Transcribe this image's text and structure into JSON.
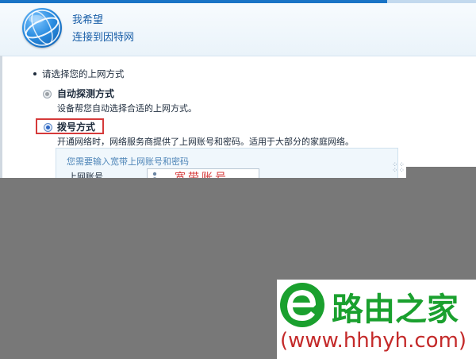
{
  "header": {
    "title": "我希望",
    "subtitle": "连接到因特网",
    "logo_icon": "globe-icon"
  },
  "question": "请选择您的上网方式",
  "options": [
    {
      "label": "自动探测方式",
      "description": "设备帮您自动选择合适的上网方式。",
      "selected": false
    },
    {
      "label": "拨号方式",
      "description": "开通网络时，网络服务商提供了上网账号和密码。适用于大部分的家庭网络。",
      "selected": true
    }
  ],
  "dial_panel": {
    "hint": "您需要输入宽带上网账号和密码",
    "account_label": "上网账号",
    "account_value": "宽带账号",
    "account_icon": "user-icon"
  },
  "colors": {
    "accent": "#1a5fa8",
    "highlight": "#d53a3a",
    "overlay": "#787878",
    "watermark_green": "#1aa02e",
    "watermark_red": "#c42a2a"
  },
  "watermark": {
    "text": "路由之家",
    "url": "(www.hhhyh.com)",
    "logo_icon": "e-logo-icon"
  }
}
